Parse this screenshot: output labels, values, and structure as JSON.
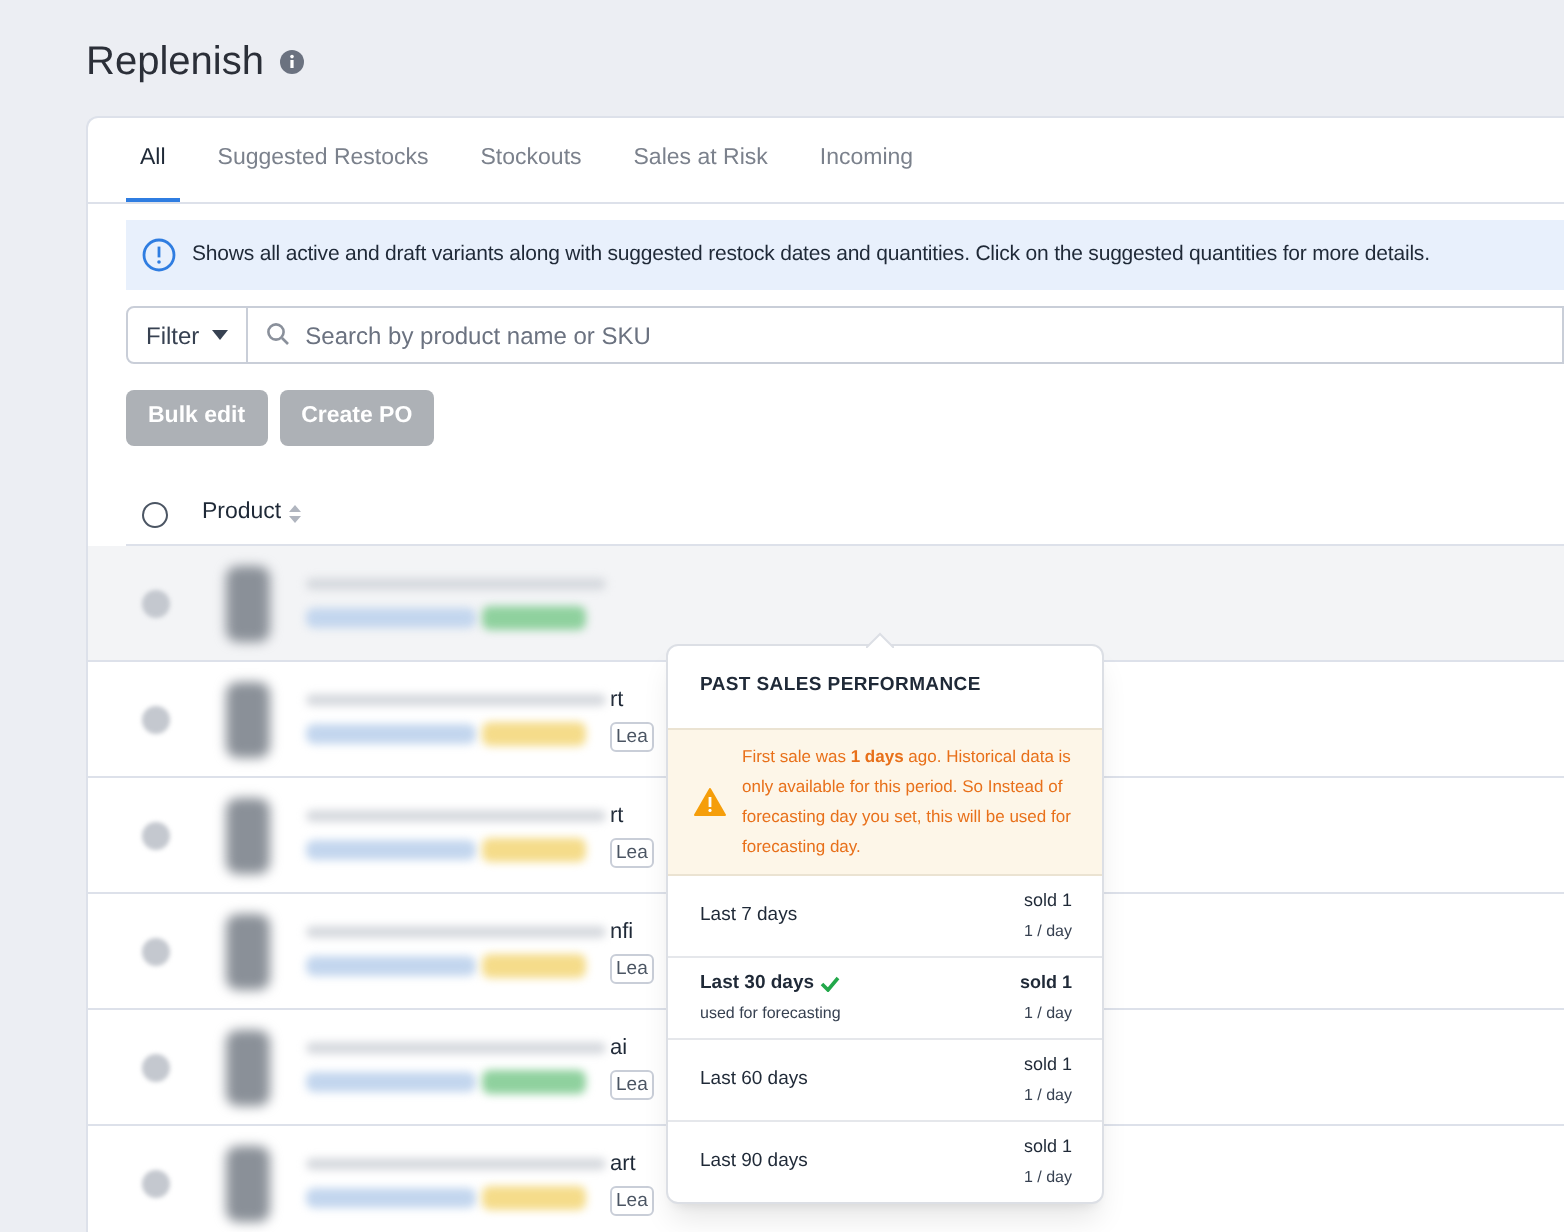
{
  "page": {
    "title": "Replenish"
  },
  "tabs": [
    {
      "label": "All",
      "selected": true
    },
    {
      "label": "Suggested Restocks",
      "selected": false
    },
    {
      "label": "Stockouts",
      "selected": false
    },
    {
      "label": "Sales at Risk",
      "selected": false
    },
    {
      "label": "Incoming",
      "selected": false
    }
  ],
  "info_banner": "Shows all active and draft variants along with suggested restock dates and quantities. Click on the suggested quantities for more details.",
  "filter": {
    "label": "Filter"
  },
  "search": {
    "placeholder": "Search by product name or SKU"
  },
  "buttons": [
    {
      "label": "Bulk edit",
      "disabled": true
    },
    {
      "label": "Create PO",
      "disabled": true
    }
  ],
  "table": {
    "columns": [
      "Product"
    ],
    "select_all": {
      "checked": false
    },
    "rows": [
      {
        "highlighted": true,
        "color": "#8fd19e"
      },
      {
        "highlighted": false,
        "color": "#f5dc8a",
        "tail_text": "rt",
        "badge": "Lea"
      },
      {
        "highlighted": false,
        "color": "#f5dc8a",
        "tail_text": "rt",
        "badge": "Lea"
      },
      {
        "highlighted": false,
        "color": "#f5dc8a",
        "tail_text": "nfi",
        "badge": "Lea"
      },
      {
        "highlighted": false,
        "color": "#8fd19e",
        "tail_text": "ai",
        "badge": "Lea"
      },
      {
        "highlighted": false,
        "color": "#f5dc8a",
        "tail_text": "art",
        "badge": "Lea"
      }
    ]
  },
  "popover": {
    "title": "PAST SALES PERFORMANCE",
    "warning": "First sale was **1 days** ago. Historical data is only available for this period. So Instead of forecasting day you set, this will be used for forecasting day.",
    "periods": [
      {
        "label": "Last 7 days",
        "sold": "sold 1",
        "rate": "1 / day",
        "used_for_forecasting": false
      },
      {
        "label": "Last 30 days",
        "sold": "sold 1",
        "rate": "1 / day",
        "used_for_forecasting": true,
        "note": "used for forecasting"
      },
      {
        "label": "Last 60 days",
        "sold": "sold 1",
        "rate": "1 / day",
        "used_for_forecasting": false
      },
      {
        "label": "Last 90 days",
        "sold": "sold 1",
        "rate": "1 / day",
        "used_for_forecasting": false
      }
    ]
  }
}
